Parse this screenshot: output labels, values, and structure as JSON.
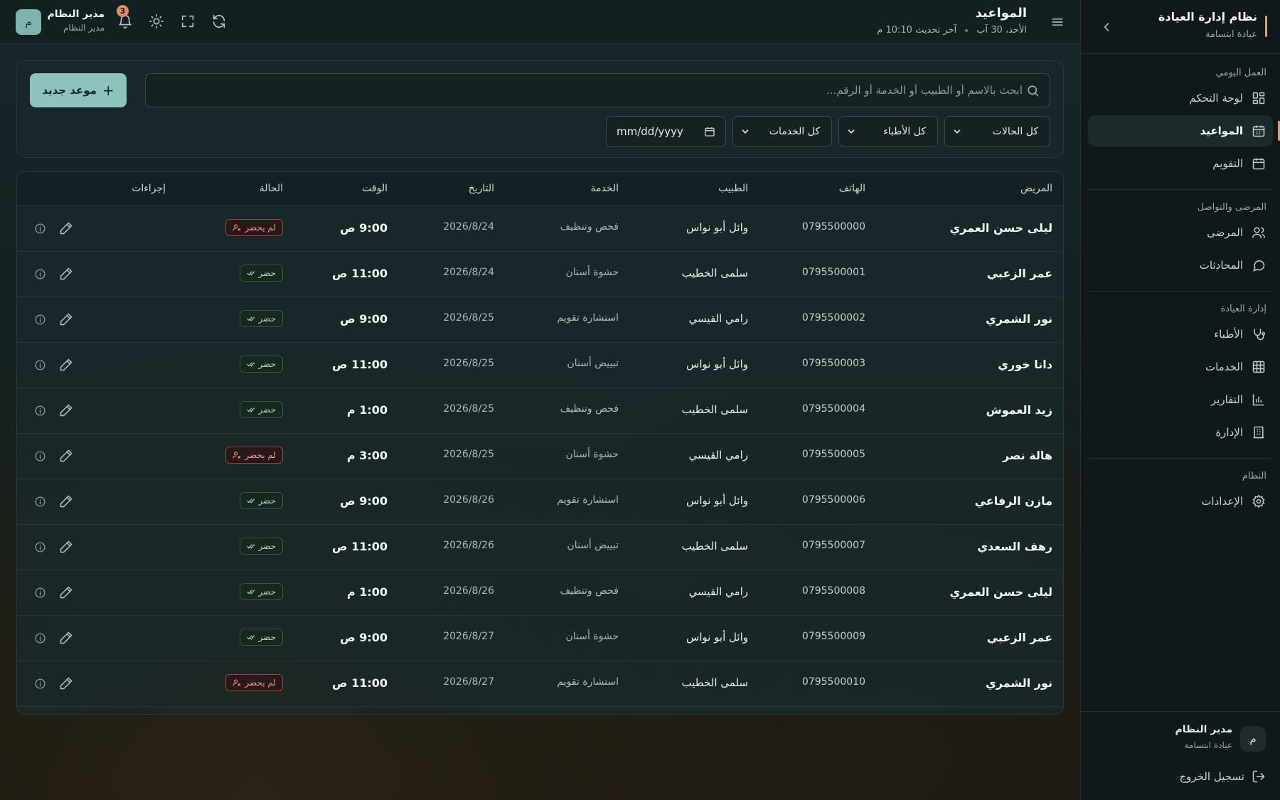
{
  "sidebar": {
    "title": "نظام إدارة العيادة",
    "subtitle": "عيادة ابتسامة",
    "sections": [
      {
        "label": "العمل اليومي",
        "items": [
          {
            "label": "لوحة التحكم",
            "icon": "dashboard-icon"
          },
          {
            "label": "المواعيد",
            "icon": "calendar-check-icon",
            "active": true
          },
          {
            "label": "التقويم",
            "icon": "calendar-icon"
          }
        ]
      },
      {
        "label": "المرضى والتواصل",
        "items": [
          {
            "label": "المرضى",
            "icon": "users-icon"
          },
          {
            "label": "المحادثات",
            "icon": "chat-icon"
          }
        ]
      },
      {
        "label": "إدارة العيادة",
        "items": [
          {
            "label": "الأطباء",
            "icon": "stethoscope-icon"
          },
          {
            "label": "الخدمات",
            "icon": "grid-icon"
          },
          {
            "label": "التقارير",
            "icon": "bar-chart-icon"
          },
          {
            "label": "الإدارة",
            "icon": "building-icon"
          }
        ]
      },
      {
        "label": "النظام",
        "items": [
          {
            "label": "الإعدادات",
            "icon": "gear-icon"
          }
        ]
      }
    ],
    "user": {
      "initial": "م",
      "name": "مدير النظام",
      "clinic": "عيادة ابتسامة"
    },
    "logout": "تسجيل الخروج"
  },
  "header": {
    "title": "المواعيد",
    "date": "الأحد، 30 آب",
    "last_update": "آخر تحديث 10:10 م",
    "notifications": "3",
    "user": {
      "initial": "م",
      "name": "مدير النظام",
      "role": "مدير النظام"
    }
  },
  "filters": {
    "search_placeholder": "ابحث بالاسم أو الطبيب أو الخدمة أو الرقم...",
    "new_button": "موعد جديد",
    "status": "كل الحالات",
    "doctors": "كل الأطباء",
    "services": "كل الخدمات",
    "date_placeholder": "mm/dd/yyyy"
  },
  "table": {
    "columns": {
      "patient": "المريض",
      "phone": "الهاتف",
      "doctor": "الطبيب",
      "service": "الخدمة",
      "date": "التاريخ",
      "time": "الوقت",
      "status": "الحالة",
      "actions": "إجراءات"
    },
    "rows": [
      {
        "patient": "ليلى حسن العمري",
        "phone": "0795500000",
        "doctor": "وائل أبو نواس",
        "service": "فحص وتنظيف",
        "date": "2026/8/24",
        "time": "9:00 ص",
        "status": "لم يحضر",
        "status_type": "no"
      },
      {
        "patient": "عمر الزعبي",
        "phone": "0795500001",
        "doctor": "سلمى الخطيب",
        "service": "حشوة أسنان",
        "date": "2026/8/24",
        "time": "11:00 ص",
        "status": "حضر",
        "status_type": "ok"
      },
      {
        "patient": "نور الشمري",
        "phone": "0795500002",
        "doctor": "رامي القيسي",
        "service": "استشارة تقويم",
        "date": "2026/8/25",
        "time": "9:00 ص",
        "status": "حضر",
        "status_type": "ok"
      },
      {
        "patient": "دانا خوري",
        "phone": "0795500003",
        "doctor": "وائل أبو نواس",
        "service": "تبييض أسنان",
        "date": "2026/8/25",
        "time": "11:00 ص",
        "status": "حضر",
        "status_type": "ok"
      },
      {
        "patient": "زيد العموش",
        "phone": "0795500004",
        "doctor": "سلمى الخطيب",
        "service": "فحص وتنظيف",
        "date": "2026/8/25",
        "time": "1:00 م",
        "status": "حضر",
        "status_type": "ok"
      },
      {
        "patient": "هالة نصر",
        "phone": "0795500005",
        "doctor": "رامي القيسي",
        "service": "حشوة أسنان",
        "date": "2026/8/25",
        "time": "3:00 م",
        "status": "لم يحضر",
        "status_type": "no"
      },
      {
        "patient": "مازن الرفاعي",
        "phone": "0795500006",
        "doctor": "وائل أبو نواس",
        "service": "استشارة تقويم",
        "date": "2026/8/26",
        "time": "9:00 ص",
        "status": "حضر",
        "status_type": "ok"
      },
      {
        "patient": "رهف السعدي",
        "phone": "0795500007",
        "doctor": "سلمى الخطيب",
        "service": "تبييض أسنان",
        "date": "2026/8/26",
        "time": "11:00 ص",
        "status": "حضر",
        "status_type": "ok"
      },
      {
        "patient": "ليلى حسن العمري",
        "phone": "0795500008",
        "doctor": "رامي القيسي",
        "service": "فحص وتنظيف",
        "date": "2026/8/26",
        "time": "1:00 م",
        "status": "حضر",
        "status_type": "ok"
      },
      {
        "patient": "عمر الزعبي",
        "phone": "0795500009",
        "doctor": "وائل أبو نواس",
        "service": "حشوة أسنان",
        "date": "2026/8/27",
        "time": "9:00 ص",
        "status": "حضر",
        "status_type": "ok"
      },
      {
        "patient": "نور الشمري",
        "phone": "0795500010",
        "doctor": "سلمى الخطيب",
        "service": "استشارة تقويم",
        "date": "2026/8/27",
        "time": "11:00 ص",
        "status": "لم يحضر",
        "status_type": "no"
      }
    ]
  },
  "colors": {
    "accent": "#e59a6e",
    "primary_button": "#8ec2bd",
    "status_ok": "#2f5a3d",
    "status_no": "#a43d3d"
  }
}
